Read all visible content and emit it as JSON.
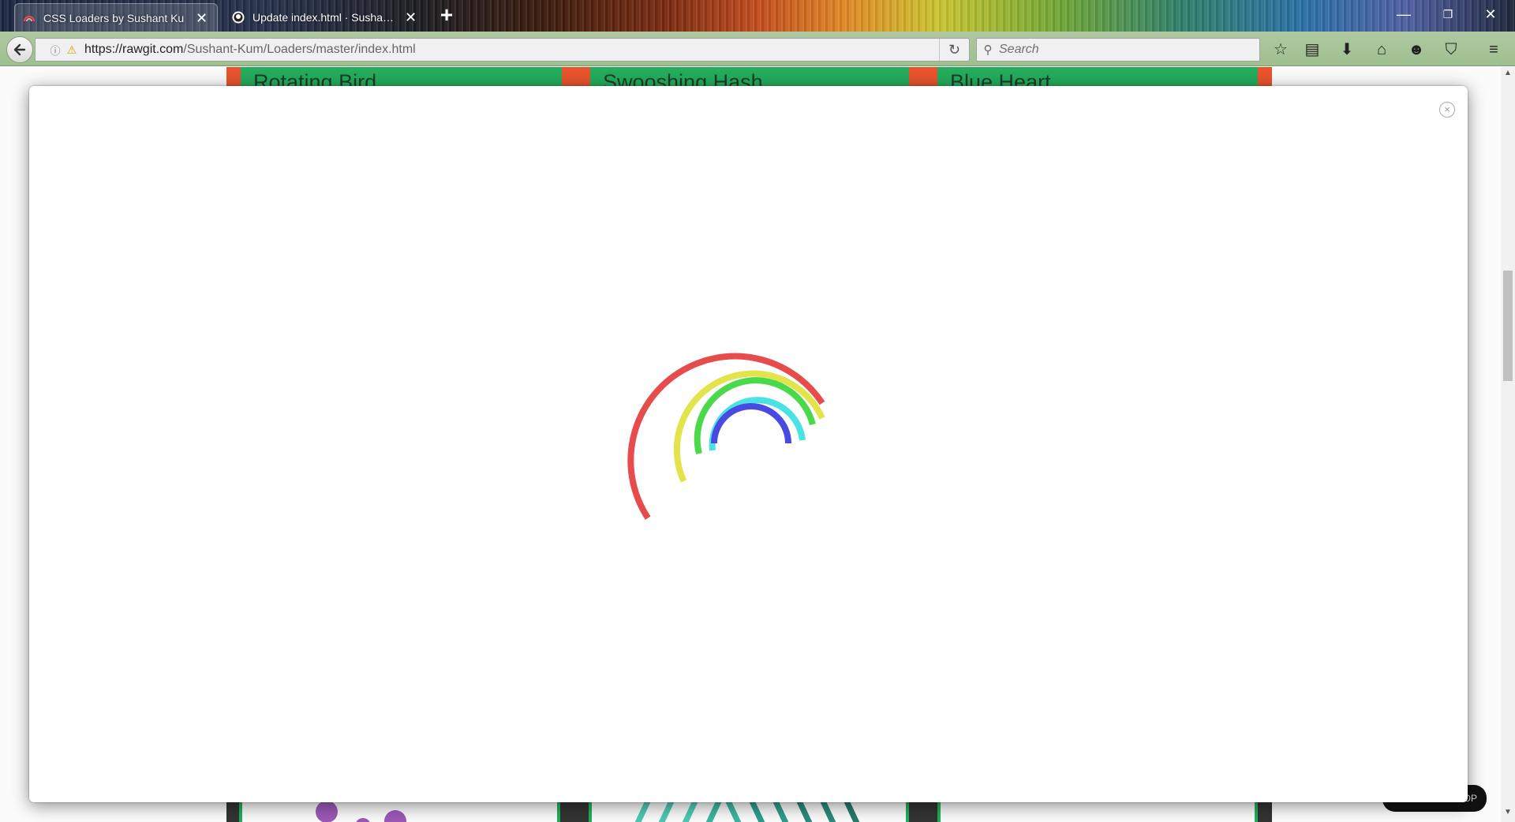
{
  "browser": {
    "tabs": [
      {
        "title": "CSS Loaders by Sushant Ku",
        "active": true
      },
      {
        "title": "Update index.html · Susha…",
        "active": false
      }
    ],
    "url_host": "https://rawgit.com",
    "url_path": "/Sushant-Kum/Loaders/master/index.html",
    "search_placeholder": "Search",
    "new_tab_symbol": "+",
    "tab_close_symbol": "✕",
    "window_controls": {
      "minimize": "—",
      "restore": "❐",
      "close": "✕"
    }
  },
  "page": {
    "cards": [
      {
        "title": "Rotating Bird"
      },
      {
        "title": "Swooshing Hash"
      },
      {
        "title": "Blue Heart"
      }
    ],
    "scroll_top_label": "OP"
  },
  "modal": {
    "close_symbol": "×",
    "loader": {
      "name": "rainbow-loader",
      "arc_colors": [
        "#e74c4c",
        "#e3e34a",
        "#4ad94a",
        "#4ae3e3",
        "#4a4ae3"
      ]
    }
  }
}
